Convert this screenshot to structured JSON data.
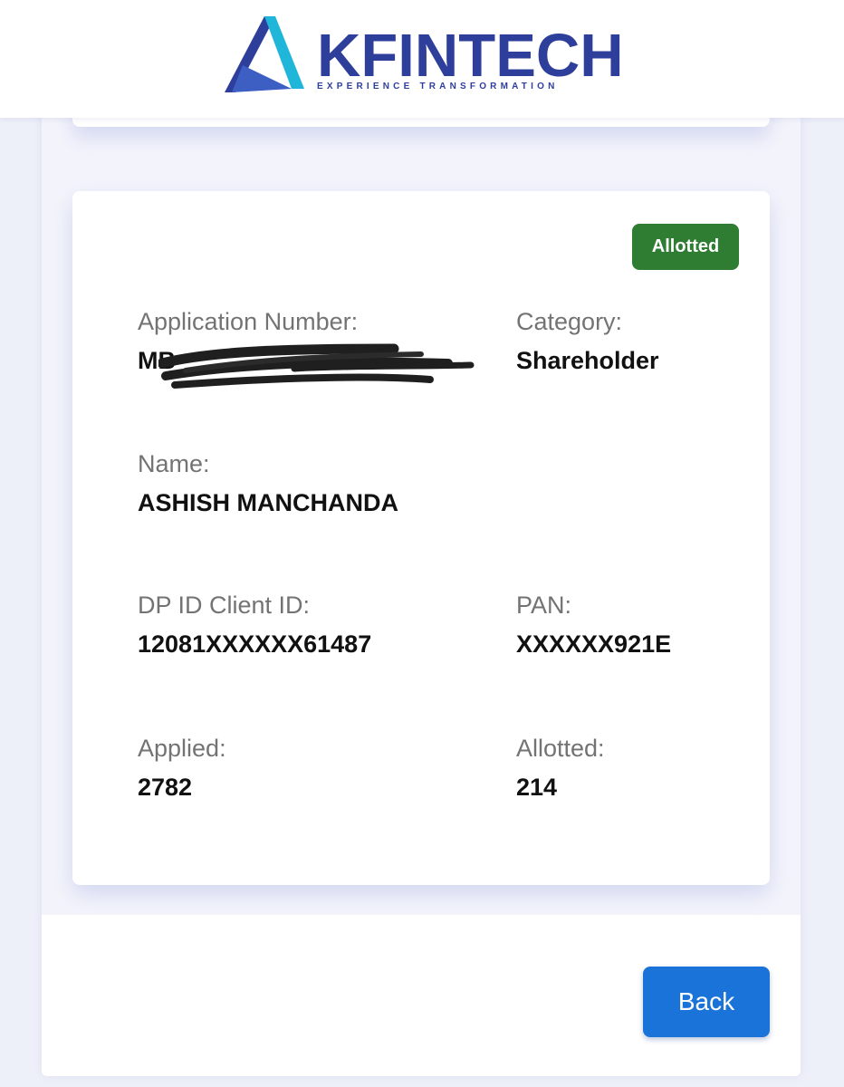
{
  "header": {
    "logo_word": "KFINTECH",
    "logo_tagline": "EXPERIENCE TRANSFORMATION",
    "logo_icon": "kfintech-logo-icon"
  },
  "result": {
    "status": "Allotted",
    "fields": {
      "application_number": {
        "label": "Application Number:",
        "value": "MB"
      },
      "category": {
        "label": "Category:",
        "value": "Shareholder"
      },
      "name": {
        "label": "Name:",
        "value": "ASHISH MANCHANDA"
      },
      "dp_client_id": {
        "label": "DP ID Client ID:",
        "value": "12081XXXXXX61487"
      },
      "pan": {
        "label": "PAN:",
        "value": "XXXXXX921E"
      },
      "applied": {
        "label": "Applied:",
        "value": "2782"
      },
      "allotted": {
        "label": "Allotted:",
        "value": "214"
      }
    }
  },
  "actions": {
    "back_label": "Back"
  },
  "colors": {
    "brand_blue": "#2e3f9b",
    "brand_cyan": "#1fb6d9",
    "status_green": "#2e7d32",
    "button_blue": "#1a73d8",
    "page_background": "#eef0f9"
  }
}
